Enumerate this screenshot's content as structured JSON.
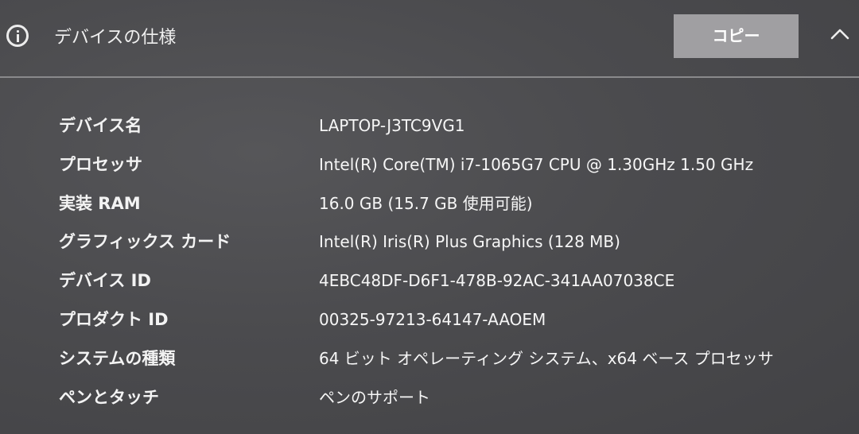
{
  "header": {
    "title": "デバイスの仕様",
    "copy_label": "コピー",
    "info_icon": "info-icon",
    "collapse_icon": "chevron-up-icon"
  },
  "specs": [
    {
      "label": "デバイス名",
      "value": "LAPTOP-J3TC9VG1"
    },
    {
      "label": "プロセッサ",
      "value": "Intel(R) Core(TM) i7-1065G7 CPU @ 1.30GHz   1.50 GHz"
    },
    {
      "label": "実装 RAM",
      "value": "16.0 GB (15.7 GB 使用可能)"
    },
    {
      "label": "グラフィックス カード",
      "value": "Intel(R) Iris(R) Plus Graphics (128 MB)"
    },
    {
      "label": "デバイス ID",
      "value": "4EBC48DF-D6F1-478B-92AC-341AA07038CE"
    },
    {
      "label": "プロダクト ID",
      "value": "00325-97213-64147-AAOEM"
    },
    {
      "label": "システムの種類",
      "value": "64 ビット オペレーティング システム、x64 ベース プロセッサ"
    },
    {
      "label": "ペンとタッチ",
      "value": "ペンのサポート"
    }
  ],
  "colors": {
    "background": "#4a4a4d",
    "button": "#a09fa2",
    "text": "#f2f2f2",
    "divider": "#8a8a8c"
  }
}
